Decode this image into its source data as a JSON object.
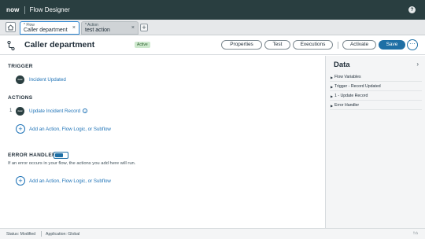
{
  "header": {
    "logo": "now",
    "app_title": "Flow Designer",
    "help_glyph": "?"
  },
  "tabs": [
    {
      "sub": "* Flow",
      "main": "Caller department",
      "close": "×"
    },
    {
      "sub": "* Action",
      "main": "test action",
      "close": "×"
    }
  ],
  "tab_add": "+",
  "flow": {
    "name": "Caller department",
    "status_badge": "Active",
    "buttons": {
      "properties": "Properties",
      "test": "Test",
      "executions": "Executions",
      "activate": "Activate",
      "save": "Save",
      "more": "⋯"
    }
  },
  "trigger": {
    "heading": "TRIGGER",
    "icon_text": "now",
    "label": "Incident Updated"
  },
  "actions": {
    "heading": "ACTIONS",
    "steps": [
      {
        "number": "1",
        "icon_text": "now",
        "label": "Update Incident Record"
      }
    ],
    "add_label": "Add an Action, Flow Logic, or Subflow"
  },
  "error_handler": {
    "heading": "ERROR HANDLER",
    "toggle_on": true,
    "helper": "If an error occurs in your flow, the actions you add here will run.",
    "add_label": "Add an Action, Flow Logic, or Subflow"
  },
  "data_panel": {
    "title": "Data",
    "items": [
      "Flow Variables",
      "Trigger - Record Updated",
      "1 - Update Record",
      "Error Handler"
    ]
  },
  "statusbar": {
    "status": "Status: Modified",
    "application": "Application: Global"
  },
  "colors": {
    "topbar": "#293e40",
    "accent": "#1e6fa5",
    "link": "#1f73b7"
  },
  "icons": [
    "home-icon",
    "flow-icon",
    "help-icon",
    "info-icon",
    "plus-icon",
    "chevron-right-icon",
    "user-icon"
  ]
}
